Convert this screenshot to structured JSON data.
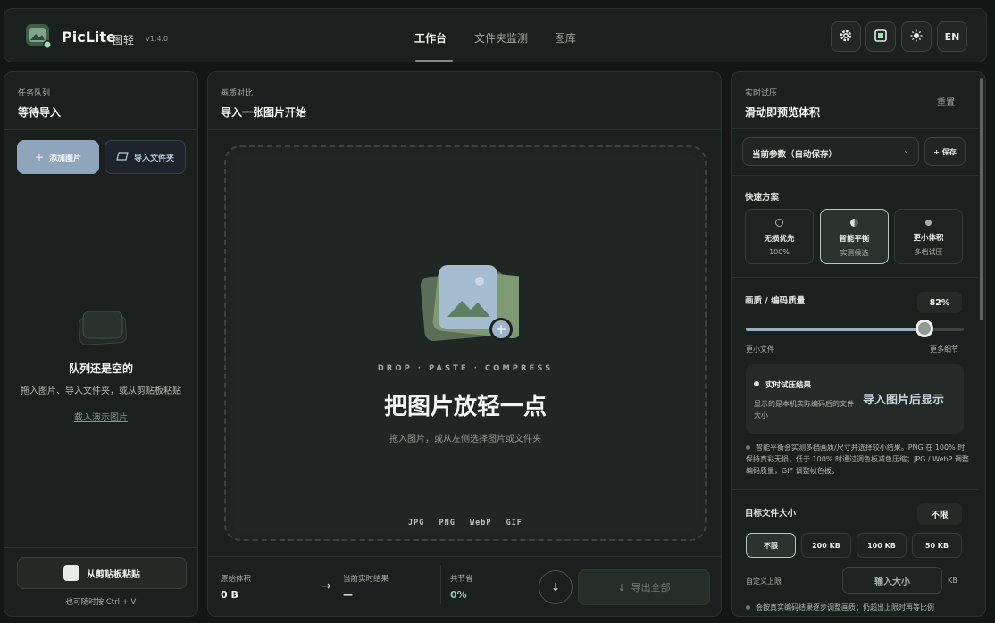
{
  "header": {
    "brand": "PicLite",
    "brand_cn": "图轻",
    "version": "v1.4.0",
    "tabs": [
      {
        "label": "工作台",
        "active": true
      },
      {
        "label": "文件夹监测",
        "active": false
      },
      {
        "label": "图库",
        "active": false
      }
    ],
    "lang_label": "EN"
  },
  "left": {
    "section_label": "任务队列",
    "title": "等待导入",
    "add_button": "添加图片",
    "folder_button": "导入文件夹",
    "empty_title": "队列还是空的",
    "empty_desc": "拖入图片、导入文件夹，或从剪贴板粘贴",
    "demo_link": "载入演示图片",
    "paste_button": "从剪贴板粘贴",
    "paste_hint": "也可随时按 Ctrl + V"
  },
  "center": {
    "section_label": "画质对比",
    "title": "导入一张图片开始",
    "drop_caps": "DROP · PASTE · COMPRESS",
    "drop_title": "把图片放轻一点",
    "drop_sub": "拖入图片，或从左侧选择图片或文件夹",
    "formats": "JPG PNG WebP GIF",
    "original_label": "原始体积",
    "original_value": "0 B",
    "arrow": "→",
    "current_label": "当前实时结果",
    "current_value": "—",
    "saved_label": "共节省",
    "saved_value": "0%",
    "export_label": "导出全部",
    "download_glyph": "↓"
  },
  "right": {
    "section_label": "实时试压",
    "title": "滑动即预览体积",
    "reset": "重置",
    "preset_select": "当前参数（自动保存）",
    "save_button": "+ 保存",
    "quick_label": "快速方案",
    "schemes": [
      {
        "title": "无损优先",
        "sub": "100%",
        "active": false
      },
      {
        "title": "智能平衡",
        "sub": "实测候选",
        "active": true
      },
      {
        "title": "更小体积",
        "sub": "多档试压",
        "active": false
      }
    ],
    "quality_label": "画质 / 编码质量",
    "quality_value": "82%",
    "quality": 0.82,
    "slider_min_label": "更小文件",
    "slider_max_label": "更多细节",
    "result_title": "实时试压结果",
    "result_desc": "显示的是本机实际编码后的文件大小",
    "result_big": "导入图片后显示",
    "note": "智能平衡会实测多档画质/尺寸并选择较小结果。PNG 在 100% 时保持真彩无损，低于 100% 时通过调色板减色压缩；JPG / WebP 调整编码质量，GIF 调整帧色板。",
    "target_label": "目标文件大小",
    "target_value": "不限",
    "size_options": [
      {
        "label": "不限",
        "active": true
      },
      {
        "label": "200 KB",
        "active": false
      },
      {
        "label": "100 KB",
        "active": false
      },
      {
        "label": "50 KB",
        "active": false
      }
    ],
    "custom_label": "自定义上限",
    "custom_placeholder": "输入大小",
    "kb_unit": "KB",
    "note2": "会按真实编码结果逐步调整画质；仍超出上限时再等比例"
  },
  "colors": {
    "accent_blue": "#8ea5bc",
    "background": "#121614",
    "panel": "#1a201d"
  }
}
